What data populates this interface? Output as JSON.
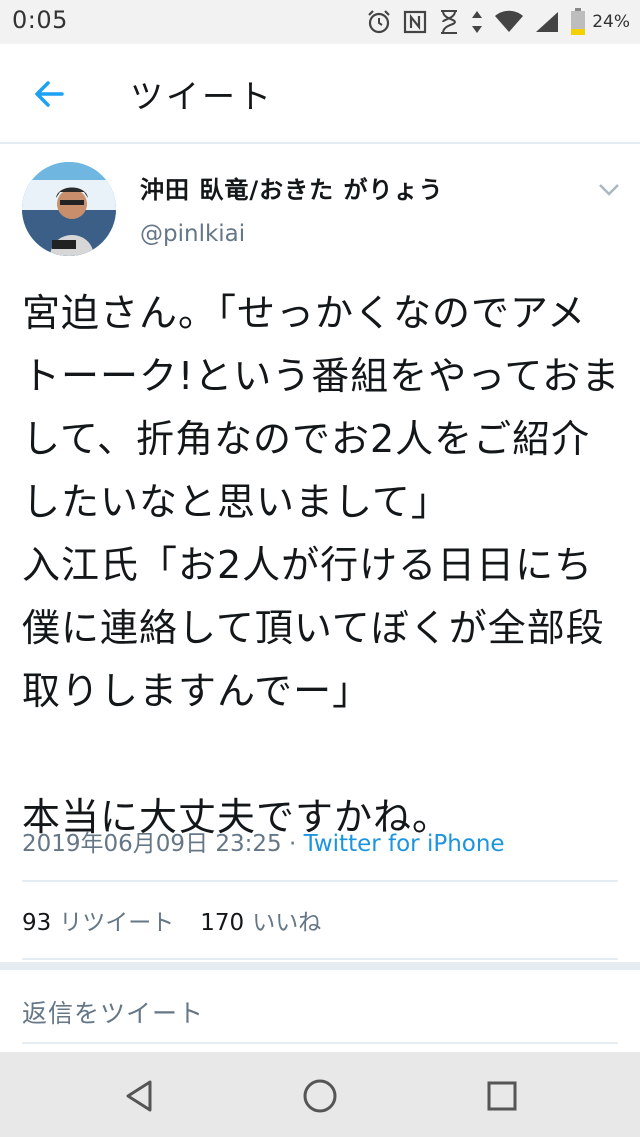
{
  "status_bar": {
    "time": "0:05",
    "battery": "24%",
    "icons": [
      "alarm-icon",
      "nfc-icon",
      "hourglass-icon",
      "data-arrows-icon",
      "wifi-icon",
      "signal-icon",
      "battery-icon"
    ]
  },
  "app_bar": {
    "title": "ツイート",
    "back_icon": "back-arrow-icon"
  },
  "tweet": {
    "display_name": "沖田 臥竜/おきた がりょう",
    "handle": "@pinlkiai",
    "text": "宮迫さん。「せっかくなのでアメトーーク!という番組をやっておまして、折角なのでお2人をご紹介したいなと思いまして」\n入江氏「お2人が行ける日日にち僕に連絡して頂いてぼくが全部段取りしますんでー」\n\n本当に大丈夫ですかね。",
    "timestamp": "2019年06月09日 23:25",
    "separator": " · ",
    "source": "Twitter for iPhone",
    "retweet_count": "93",
    "retweet_label": "リツイート",
    "like_count": "170",
    "like_label": "いいね"
  },
  "reply": {
    "placeholder": "返信をツイート"
  },
  "nav_bar": {
    "buttons": [
      "back-triangle-icon",
      "home-circle-icon",
      "recents-square-icon"
    ]
  },
  "colors": {
    "accent": "#1da1f2",
    "link": "#1b95e0",
    "secondary_text": "#657786",
    "divider": "#e6ecf0"
  }
}
